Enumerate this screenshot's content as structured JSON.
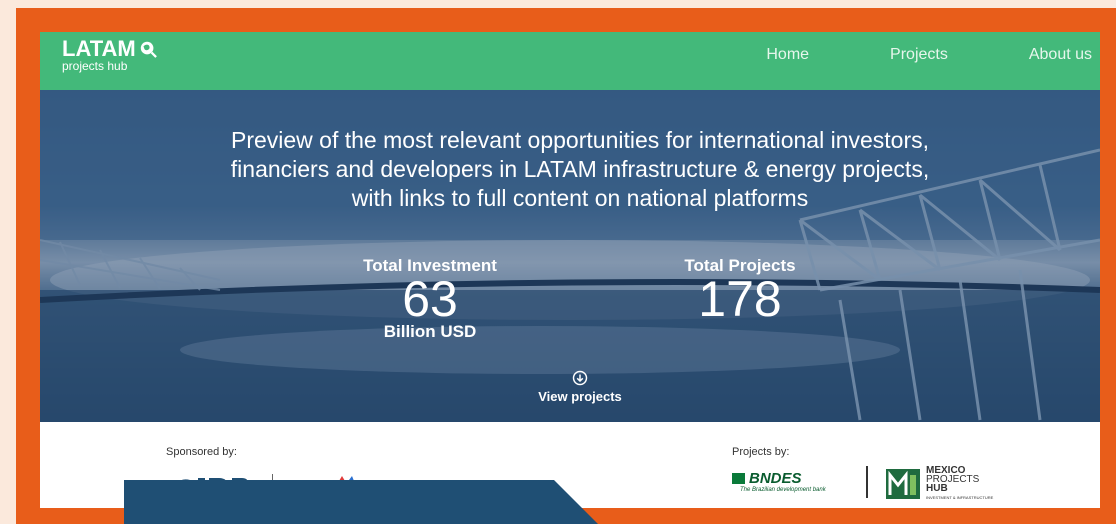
{
  "nav": {
    "logo_main": "LATAM",
    "logo_sub": "projects hub",
    "links": [
      "Home",
      "Projects",
      "About us"
    ]
  },
  "hero": {
    "headline": "Preview of the most relevant opportunities for international investors, financiers and developers in LATAM infrastructure & energy projects, with links to full content on national platforms",
    "investment": {
      "label": "Total Investment",
      "value": "63",
      "unit": "Billion USD"
    },
    "projects": {
      "label": "Total Projects",
      "value": "178"
    },
    "view_projects": "View projects"
  },
  "sponsors": {
    "sponsored_by": "Sponsored by:",
    "projects_by": "Projects by:",
    "bndes_name": "BNDES",
    "bndes_tagline": "The Brazilian development bank",
    "mph_line1": "MEXICO",
    "mph_line2": "PROJECTS",
    "mph_line3": "HUB",
    "mph_line4": "INVESTMENT & INFRASTRUCTURE"
  },
  "colors": {
    "frame": "#e85d1a",
    "navbar": "#43b97a",
    "panel": "#1f4f74",
    "background": "#fbe9dc"
  }
}
